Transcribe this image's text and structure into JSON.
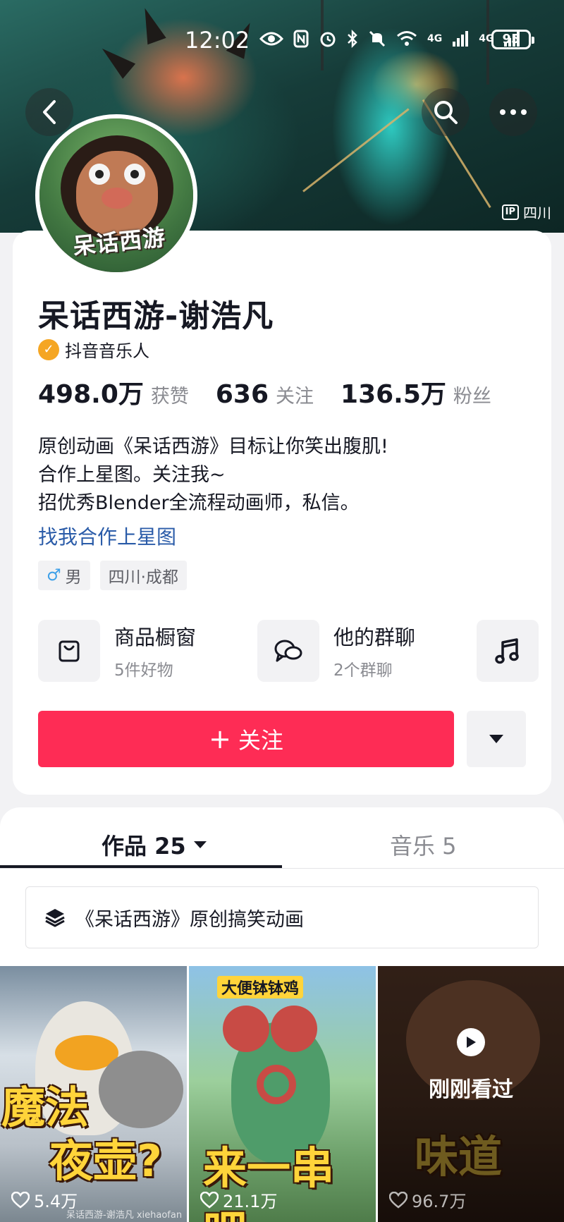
{
  "status_bar": {
    "time": "12:02",
    "network_1": "4G",
    "network_2": "4G",
    "battery": "95"
  },
  "hero": {
    "ip_box": "IP",
    "ip_location": "四川"
  },
  "profile": {
    "avatar_text": "呆话西游",
    "name": "呆话西游-谢浩凡",
    "verified_label": "抖音音乐人",
    "stats": [
      {
        "value": "498.0万",
        "label": "获赞"
      },
      {
        "value": "636",
        "label": "关注"
      },
      {
        "value": "136.5万",
        "label": "粉丝"
      }
    ],
    "bio_lines": [
      "原创动画《呆话西游》目标让你笑出腹肌!",
      "合作上星图。关注我~",
      "招优秀Blender全流程动画师，私信。"
    ],
    "bio_link": "找我合作上星图",
    "tags": {
      "gender_symbol": "♂",
      "gender": "男",
      "location": "四川·成都"
    },
    "entries": {
      "shop": {
        "title": "商品橱窗",
        "sub": "5件好物"
      },
      "group": {
        "title": "他的群聊",
        "sub": "2个群聊"
      }
    },
    "follow_label": "关注",
    "follow_plus": "+"
  },
  "tabs": {
    "works": {
      "label": "作品 25"
    },
    "music": {
      "label": "音乐 5"
    }
  },
  "collection": {
    "label": "《呆话西游》原创搞笑动画"
  },
  "videos": [
    {
      "likes": "5.4万",
      "caption_1": "魔法",
      "caption_2": "夜壶?"
    },
    {
      "likes": "21.1万",
      "top_label": "大便钵钵鸡",
      "caption": "来一串吧"
    },
    {
      "likes": "96.7万",
      "watched": "刚刚看过",
      "caption": "味道"
    }
  ],
  "watermark": "呆话西游-谢浩凡 xiehaofan",
  "colors": {
    "follow": "#fe2c55",
    "link": "#2a5ba8",
    "verify": "#f5a623"
  }
}
